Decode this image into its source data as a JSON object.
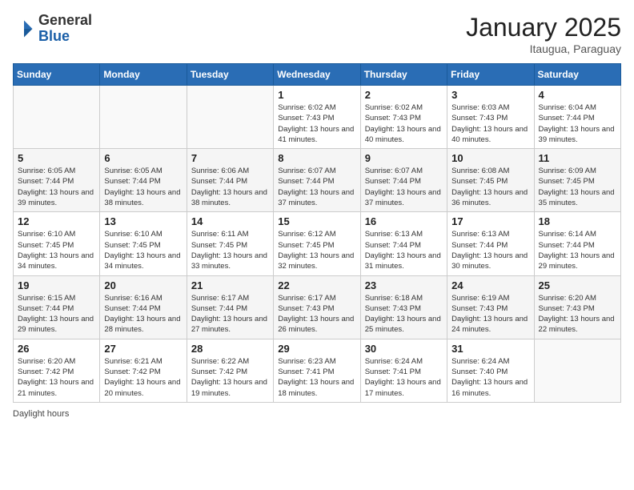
{
  "header": {
    "logo_general": "General",
    "logo_blue": "Blue",
    "month_title": "January 2025",
    "location": "Itaugua, Paraguay"
  },
  "days_of_week": [
    "Sunday",
    "Monday",
    "Tuesday",
    "Wednesday",
    "Thursday",
    "Friday",
    "Saturday"
  ],
  "weeks": [
    [
      {
        "day": "",
        "info": ""
      },
      {
        "day": "",
        "info": ""
      },
      {
        "day": "",
        "info": ""
      },
      {
        "day": "1",
        "info": "Sunrise: 6:02 AM\nSunset: 7:43 PM\nDaylight: 13 hours and 41 minutes."
      },
      {
        "day": "2",
        "info": "Sunrise: 6:02 AM\nSunset: 7:43 PM\nDaylight: 13 hours and 40 minutes."
      },
      {
        "day": "3",
        "info": "Sunrise: 6:03 AM\nSunset: 7:43 PM\nDaylight: 13 hours and 40 minutes."
      },
      {
        "day": "4",
        "info": "Sunrise: 6:04 AM\nSunset: 7:44 PM\nDaylight: 13 hours and 39 minutes."
      }
    ],
    [
      {
        "day": "5",
        "info": "Sunrise: 6:05 AM\nSunset: 7:44 PM\nDaylight: 13 hours and 39 minutes."
      },
      {
        "day": "6",
        "info": "Sunrise: 6:05 AM\nSunset: 7:44 PM\nDaylight: 13 hours and 38 minutes."
      },
      {
        "day": "7",
        "info": "Sunrise: 6:06 AM\nSunset: 7:44 PM\nDaylight: 13 hours and 38 minutes."
      },
      {
        "day": "8",
        "info": "Sunrise: 6:07 AM\nSunset: 7:44 PM\nDaylight: 13 hours and 37 minutes."
      },
      {
        "day": "9",
        "info": "Sunrise: 6:07 AM\nSunset: 7:44 PM\nDaylight: 13 hours and 37 minutes."
      },
      {
        "day": "10",
        "info": "Sunrise: 6:08 AM\nSunset: 7:45 PM\nDaylight: 13 hours and 36 minutes."
      },
      {
        "day": "11",
        "info": "Sunrise: 6:09 AM\nSunset: 7:45 PM\nDaylight: 13 hours and 35 minutes."
      }
    ],
    [
      {
        "day": "12",
        "info": "Sunrise: 6:10 AM\nSunset: 7:45 PM\nDaylight: 13 hours and 34 minutes."
      },
      {
        "day": "13",
        "info": "Sunrise: 6:10 AM\nSunset: 7:45 PM\nDaylight: 13 hours and 34 minutes."
      },
      {
        "day": "14",
        "info": "Sunrise: 6:11 AM\nSunset: 7:45 PM\nDaylight: 13 hours and 33 minutes."
      },
      {
        "day": "15",
        "info": "Sunrise: 6:12 AM\nSunset: 7:45 PM\nDaylight: 13 hours and 32 minutes."
      },
      {
        "day": "16",
        "info": "Sunrise: 6:13 AM\nSunset: 7:44 PM\nDaylight: 13 hours and 31 minutes."
      },
      {
        "day": "17",
        "info": "Sunrise: 6:13 AM\nSunset: 7:44 PM\nDaylight: 13 hours and 30 minutes."
      },
      {
        "day": "18",
        "info": "Sunrise: 6:14 AM\nSunset: 7:44 PM\nDaylight: 13 hours and 29 minutes."
      }
    ],
    [
      {
        "day": "19",
        "info": "Sunrise: 6:15 AM\nSunset: 7:44 PM\nDaylight: 13 hours and 29 minutes."
      },
      {
        "day": "20",
        "info": "Sunrise: 6:16 AM\nSunset: 7:44 PM\nDaylight: 13 hours and 28 minutes."
      },
      {
        "day": "21",
        "info": "Sunrise: 6:17 AM\nSunset: 7:44 PM\nDaylight: 13 hours and 27 minutes."
      },
      {
        "day": "22",
        "info": "Sunrise: 6:17 AM\nSunset: 7:43 PM\nDaylight: 13 hours and 26 minutes."
      },
      {
        "day": "23",
        "info": "Sunrise: 6:18 AM\nSunset: 7:43 PM\nDaylight: 13 hours and 25 minutes."
      },
      {
        "day": "24",
        "info": "Sunrise: 6:19 AM\nSunset: 7:43 PM\nDaylight: 13 hours and 24 minutes."
      },
      {
        "day": "25",
        "info": "Sunrise: 6:20 AM\nSunset: 7:43 PM\nDaylight: 13 hours and 22 minutes."
      }
    ],
    [
      {
        "day": "26",
        "info": "Sunrise: 6:20 AM\nSunset: 7:42 PM\nDaylight: 13 hours and 21 minutes."
      },
      {
        "day": "27",
        "info": "Sunrise: 6:21 AM\nSunset: 7:42 PM\nDaylight: 13 hours and 20 minutes."
      },
      {
        "day": "28",
        "info": "Sunrise: 6:22 AM\nSunset: 7:42 PM\nDaylight: 13 hours and 19 minutes."
      },
      {
        "day": "29",
        "info": "Sunrise: 6:23 AM\nSunset: 7:41 PM\nDaylight: 13 hours and 18 minutes."
      },
      {
        "day": "30",
        "info": "Sunrise: 6:24 AM\nSunset: 7:41 PM\nDaylight: 13 hours and 17 minutes."
      },
      {
        "day": "31",
        "info": "Sunrise: 6:24 AM\nSunset: 7:40 PM\nDaylight: 13 hours and 16 minutes."
      },
      {
        "day": "",
        "info": ""
      }
    ]
  ],
  "footer": {
    "daylight_label": "Daylight hours"
  }
}
